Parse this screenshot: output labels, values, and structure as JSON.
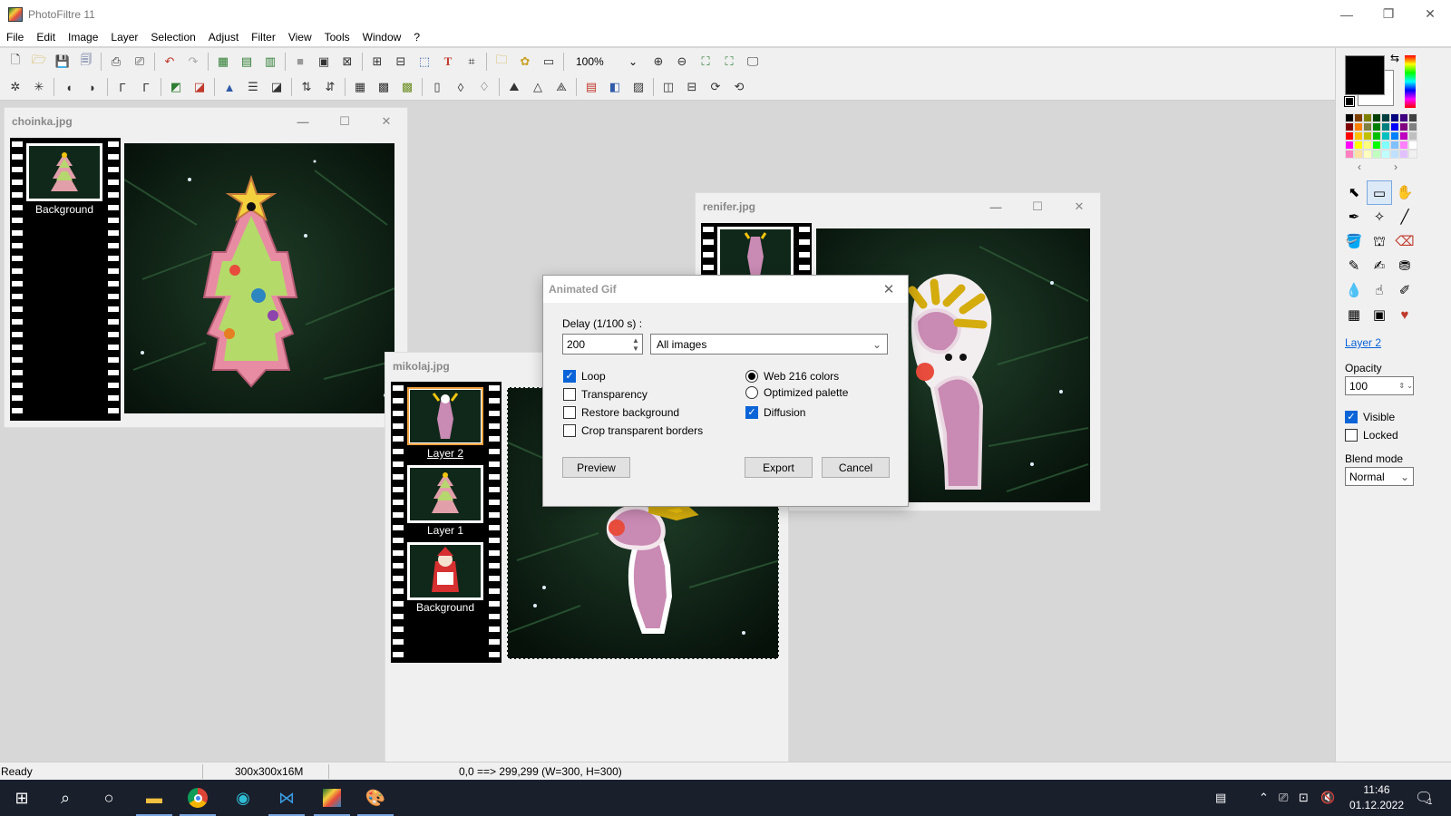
{
  "app": {
    "title": "PhotoFiltre 11"
  },
  "window_buttons": {
    "minimize": "—",
    "restore": "❐",
    "close": "✕"
  },
  "menu": [
    "File",
    "Edit",
    "Image",
    "Layer",
    "Selection",
    "Adjust",
    "Filter",
    "View",
    "Tools",
    "Window",
    "?"
  ],
  "toolbar": {
    "zoom": "100%"
  },
  "documents": {
    "choinka": {
      "title": "choinka.jpg",
      "layers": [
        "Background"
      ]
    },
    "renifer": {
      "title": "renifer.jpg"
    },
    "mikolaj": {
      "title": "mikolaj.jpg",
      "layers": [
        "Layer 2",
        "Layer 1",
        "Background"
      ]
    }
  },
  "dialog": {
    "title": "Animated Gif",
    "delay_label": "Delay (1/100 s) :",
    "delay_value": "200",
    "scope_value": "All images",
    "checkboxes": [
      {
        "label": "Loop",
        "checked": true
      },
      {
        "label": "Transparency",
        "checked": false
      },
      {
        "label": "Restore background",
        "checked": false
      },
      {
        "label": "Crop transparent borders",
        "checked": false
      }
    ],
    "palette": [
      {
        "label": "Web 216 colors",
        "selected": true
      },
      {
        "label": "Optimized palette",
        "selected": false
      }
    ],
    "diffusion": {
      "label": "Diffusion",
      "checked": true
    },
    "buttons": {
      "preview": "Preview",
      "export": "Export",
      "cancel": "Cancel"
    }
  },
  "layer_panel": {
    "layer_name": "Layer 2",
    "opacity_label": "Opacity",
    "opacity_value": "100",
    "visible_label": "Visible",
    "visible_checked": true,
    "locked_label": "Locked",
    "locked_checked": false,
    "blend_label": "Blend mode",
    "blend_value": "Normal"
  },
  "colors": {
    "foreground": "#000000",
    "background": "#ffffff",
    "accent": "#0a64d8",
    "palette": [
      "#000000",
      "#804000",
      "#808000",
      "#004000",
      "#004040",
      "#000080",
      "#400080",
      "#404040",
      "#800000",
      "#ff8000",
      "#808040",
      "#008000",
      "#008080",
      "#0000ff",
      "#800080",
      "#808080",
      "#ff0000",
      "#ffc000",
      "#c0c000",
      "#00c000",
      "#00c0c0",
      "#0080ff",
      "#c000c0",
      "#c0c0c0",
      "#ff00ff",
      "#ffff00",
      "#ffff80",
      "#00ff00",
      "#80ffff",
      "#80c0ff",
      "#ff80ff",
      "#ffffff",
      "#ff80c0",
      "#ffe0a0",
      "#ffffc0",
      "#c0ffc0",
      "#c0ffff",
      "#c0e0ff",
      "#e0c0ff",
      "#f0f0f0"
    ]
  },
  "status": {
    "state": "Ready",
    "size": "300x300x16M",
    "coords": "0,0 ==> 299,299 (W=300, H=300)"
  },
  "taskbar": {
    "time": "11:46",
    "date": "01.12.2022",
    "notifications": "1"
  }
}
